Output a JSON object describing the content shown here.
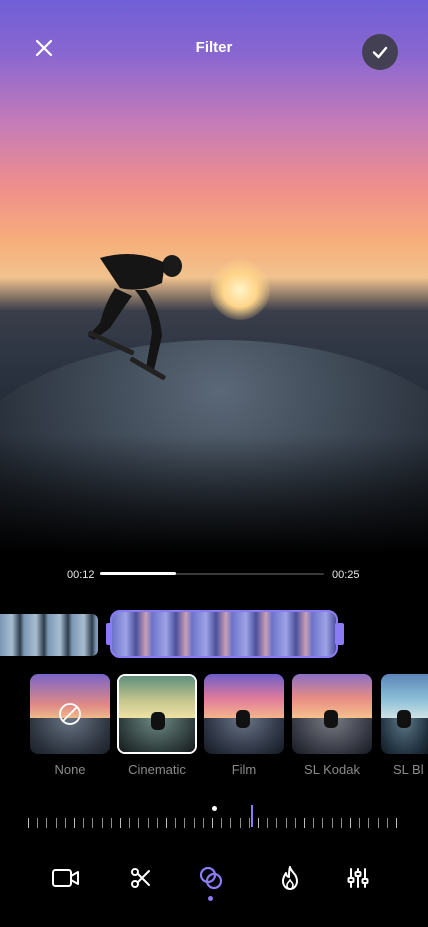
{
  "header": {
    "title": "Filter",
    "close_icon": "close-icon",
    "confirm_icon": "check-icon"
  },
  "timeline": {
    "current_time": "00:12",
    "total_time": "00:25",
    "progress": 0.34
  },
  "filters": [
    {
      "label": "None",
      "selected": false
    },
    {
      "label": "Cinematic",
      "selected": true
    },
    {
      "label": "Film",
      "selected": false
    },
    {
      "label": "SL Kodak",
      "selected": false
    },
    {
      "label": "SL Bl",
      "selected": false
    }
  ],
  "intensity": {
    "level": 0.6
  },
  "bottom_nav": [
    {
      "icon": "video-camera-icon",
      "active": false
    },
    {
      "icon": "scissors-icon",
      "active": false
    },
    {
      "icon": "filter-circles-icon",
      "active": true
    },
    {
      "icon": "flame-icon",
      "active": false
    },
    {
      "icon": "sliders-icon",
      "active": false
    }
  ],
  "colors": {
    "accent": "#8b7cf6",
    "background": "#000000"
  }
}
